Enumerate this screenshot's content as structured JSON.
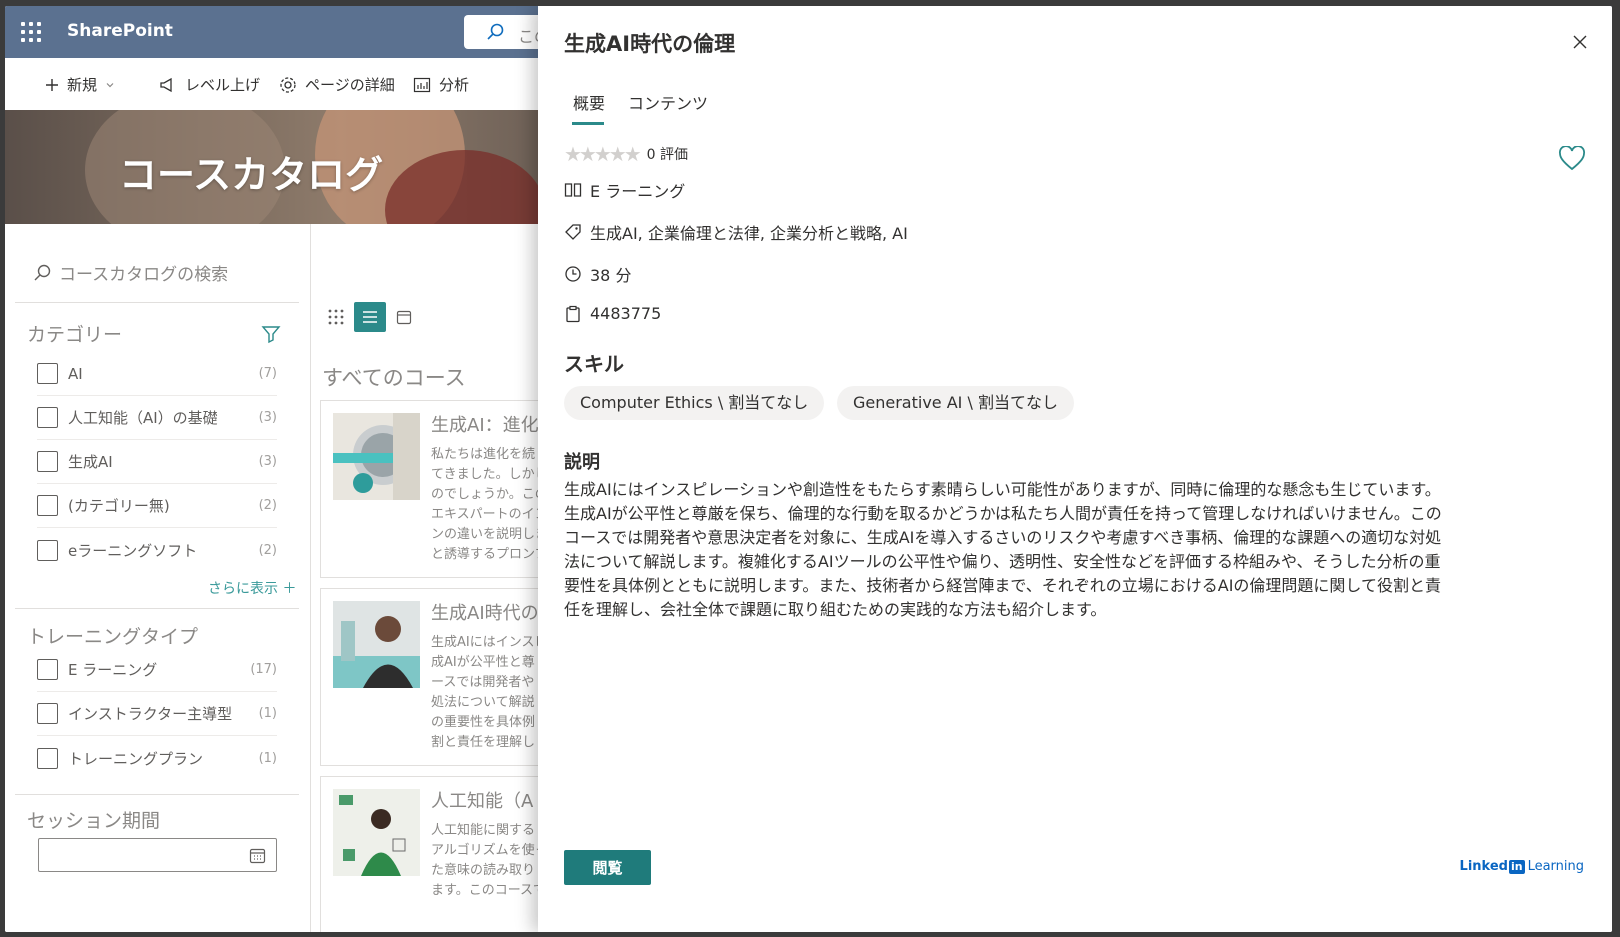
{
  "suite_bar": {
    "app_name": "SharePoint",
    "search_placeholder": "このサ"
  },
  "command_bar": {
    "new": "新規",
    "promote": "レベル上げ",
    "page_details": "ページの詳細",
    "analytics": "分析"
  },
  "hero": {
    "title": "コースカタログ"
  },
  "left_nav": {
    "search_placeholder": "コースカタログの検索",
    "category": {
      "title": "カテゴリー",
      "items": [
        {
          "label": "AI",
          "count": "(7)"
        },
        {
          "label": "人工知能（AI）の基礎",
          "count": "(3)"
        },
        {
          "label": "生成AI",
          "count": "(3)"
        },
        {
          "label": "(カテゴリー無)",
          "count": "(2)"
        },
        {
          "label": "eラーニングソフト",
          "count": "(2)"
        }
      ],
      "show_more": "さらに表示 ＋"
    },
    "training_type": {
      "title": "トレーニングタイプ",
      "items": [
        {
          "label": "E ラーニング",
          "count": "(17)"
        },
        {
          "label": "インストラクター主導型",
          "count": "(1)"
        },
        {
          "label": "トレーニングプラン",
          "count": "(1)"
        }
      ]
    },
    "session_period": {
      "title": "セッション期間"
    }
  },
  "course_list": {
    "heading": "すべてのコース",
    "cards": [
      {
        "title": "生成AI：進化",
        "lines": [
          "私たちは進化を続",
          "てきました。しかし、",
          "のでしょうか。このコ",
          "エキスパートのインタ",
          "ンの違いを説明しま",
          "と誘導するプロンプ"
        ]
      },
      {
        "title": "生成AI時代の",
        "lines": [
          "生成AIにはインスピ",
          "成AIが公平性と尊",
          "ースでは開発者や",
          "処法について解説",
          "の重要性を具体例",
          "割と責任を理解し"
        ]
      },
      {
        "title": "人工知能（A",
        "lines": [
          "人工知能に関する",
          "アルゴリズムを使っ",
          "た意味の読み取り",
          "ます。このコースでは"
        ]
      }
    ]
  },
  "panel": {
    "title": "生成AI時代の倫理",
    "tabs": {
      "overview": "概要",
      "contents": "コンテンツ"
    },
    "rating_text": "0 評価",
    "rating_value": 0,
    "training_type": "E ラーニング",
    "tags": "生成AI, 企業倫理と法律, 企業分析と戦略, AI",
    "duration": "38 分",
    "course_id": "4483775",
    "skills_heading": "スキル",
    "skills": [
      "Computer Ethics \\ 割当てなし",
      "Generative AI \\ 割当てなし"
    ],
    "description_heading": "説明",
    "description_lines": [
      "生成AIにはインスピレーションや創造性をもたらす素晴らしい可能性がありますが、同時に倫理的な懸念も生じています。",
      "生成AIが公平性と尊厳を保ち、倫理的な行動を取るかどうかは私たち人間が責任を持って管理しなければいけません。この",
      "コースでは開発者や意思決定者を対象に、生成AIを導入するさいのリスクや考慮すべき事柄、倫理的な課題への適切な対処",
      "法について解説します。複雑化するAIツールの公平性や偏り、透明性、安全性などを評価する枠組みや、そうした分析の重",
      "要性を具体例とともに説明します。また、技術者から経営陣まで、それぞれの立場におけるAIの倫理問題に関して役割と責",
      "任を理解し、会社全体で課題に取り組むための実践的な方法も紹介します。"
    ],
    "view_button": "閲覧",
    "brand": {
      "linked": "Linked",
      "in": "in",
      "learning": "Learning"
    }
  }
}
